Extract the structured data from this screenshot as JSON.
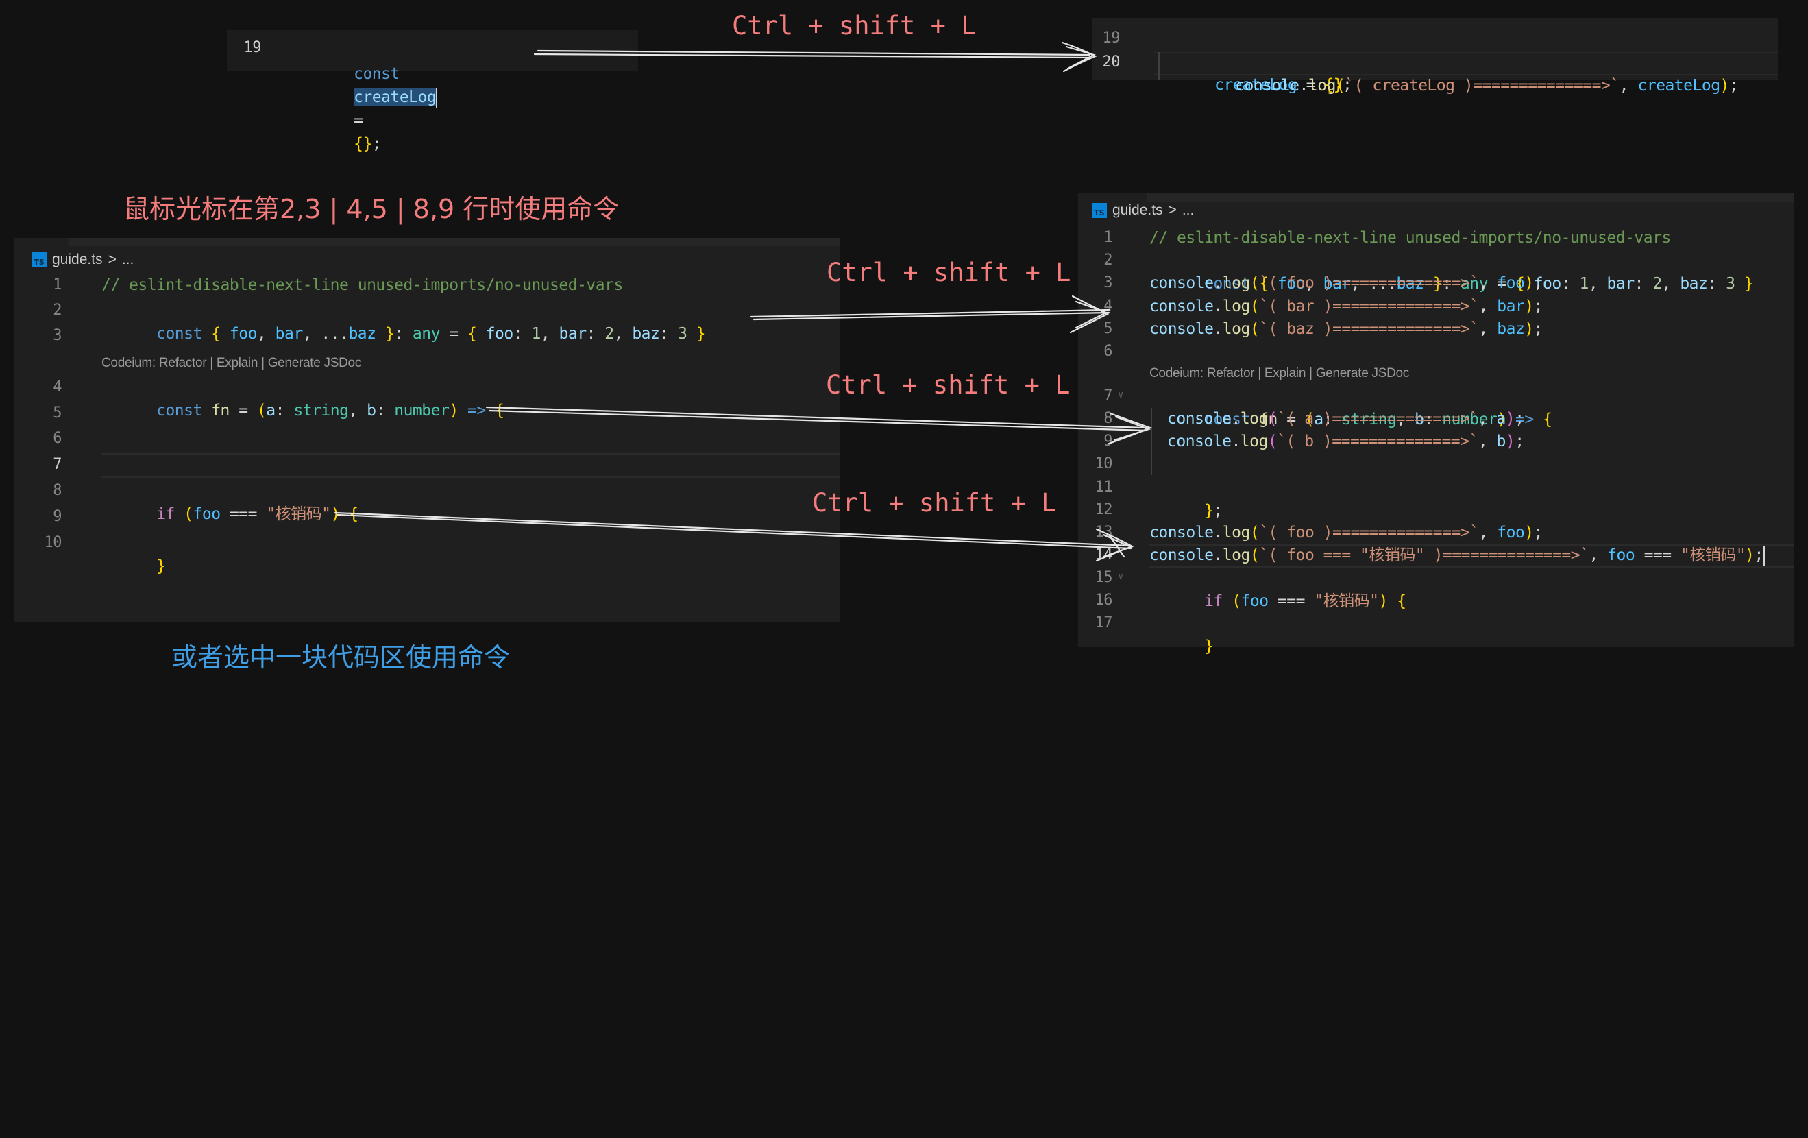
{
  "top_left_snippet": {
    "line_number": "19",
    "tokens": {
      "kw": "const",
      "name": "createLog",
      "eq": "=",
      "obj": "{}",
      "semi": ";"
    }
  },
  "top_right_snippet": {
    "lines": [
      {
        "n": "19",
        "kw": "const",
        "name": "createLog",
        "rest": " = ",
        "obj": "{}",
        "semi": ";"
      },
      {
        "n": "20",
        "fn": "console",
        "dot": ".",
        "method": "log",
        "open": "(",
        "str": "`( createLog )==============>`",
        "comma": ", ",
        "arg": "createLog",
        "close": ")",
        "semi": ";"
      }
    ]
  },
  "hints": {
    "top": "Ctrl + shift + L",
    "mid1": "Ctrl + shift + L",
    "mid2": "Ctrl + shift + L",
    "mid3": "Ctrl + shift + L"
  },
  "captions": {
    "cursor_lines": "鼠标光标在第2,3 | 4,5 | 8,9 行时使用命令",
    "select_block": "或者选中一块代码区使用命令"
  },
  "left_editor": {
    "breadcrumb": {
      "file": "guide.ts",
      "sep": ">",
      "rest": "..."
    },
    "file_icon": "TS",
    "codelens": "Codeium: Refactor | Explain | Generate JSDoc",
    "line_numbers": [
      "1",
      "2",
      "3",
      "4",
      "5",
      "6",
      "7",
      "8",
      "9",
      "10"
    ],
    "line1": "// eslint-disable-next-line unused-imports/no-unused-vars",
    "line2": {
      "kw": "const",
      "lb": "{",
      "a": " foo",
      "c1": ",",
      "b": " bar",
      "c2": ", ...",
      "c": "baz",
      "rb": " }",
      "colon": ": ",
      "ty": "any",
      "eq": " = ",
      "lb2": "{",
      "k1": " foo",
      "c3": ": ",
      "v1": "1",
      "c4": ", ",
      "k2": "bar",
      "c5": ": ",
      "v2": "2",
      "c6": ", ",
      "k3": "baz",
      "c7": ": ",
      "v3": "3",
      "rb2": " }"
    },
    "line4": {
      "kw": "const",
      "name": " fn",
      "eq": " = ",
      "lp": "(",
      "a": "a",
      "c1": ": ",
      "t1": "string",
      "c2": ", ",
      "b": "b",
      "c3": ": ",
      "t2": "number",
      "rp": ")",
      "arrow": " => ",
      "lb": "{"
    },
    "line6": {
      "rb": "}",
      "semi": ";"
    },
    "line8": {
      "kw": "if",
      "sp": " ",
      "lp": "(",
      "var": "foo",
      "op": " === ",
      "str": "\"核销码\"",
      "rp": ")",
      "sp2": " ",
      "lb": "{"
    },
    "line10": {
      "rb": "}"
    }
  },
  "right_editor": {
    "breadcrumb": {
      "file": "guide.ts",
      "sep": ">",
      "rest": "..."
    },
    "file_icon": "TS",
    "codelens": "Codeium: Refactor | Explain | Generate JSDoc",
    "line_numbers": [
      "1",
      "2",
      "3",
      "4",
      "5",
      "6",
      "7",
      "8",
      "9",
      "10",
      "11",
      "12",
      "13",
      "14",
      "15",
      "16",
      "17"
    ],
    "line1": "// eslint-disable-next-line unused-imports/no-unused-vars",
    "logs": [
      {
        "str": "`( foo )==============>`",
        "arg": "foo"
      },
      {
        "str": "`( bar )==============>`",
        "arg": "bar"
      },
      {
        "str": "`( baz )==============>`",
        "arg": "baz"
      },
      {
        "str": "`( a )==============>`",
        "arg": "a"
      },
      {
        "str": "`( b )==============>`",
        "arg": "b"
      },
      {
        "str": "`( foo )==============>`",
        "arg": "foo"
      },
      {
        "str": "`( foo === \"核销码\" )==============>`",
        "arg": "foo",
        "arg_op": " === ",
        "arg_str": "\"核销码\""
      }
    ],
    "console": "console",
    "log": "log"
  }
}
